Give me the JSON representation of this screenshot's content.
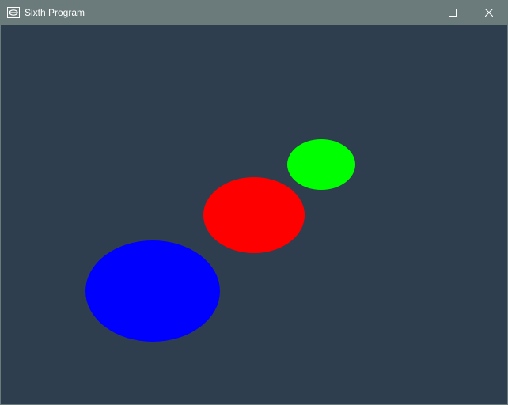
{
  "window": {
    "title": "Sixth Program",
    "controls": {
      "minimize_icon": "minimize-icon",
      "maximize_icon": "maximize-icon",
      "close_icon": "close-icon"
    }
  },
  "canvas": {
    "background": "#2e3e4f",
    "shapes": [
      {
        "name": "green-ellipse",
        "color": "#00ff00"
      },
      {
        "name": "red-ellipse",
        "color": "#ff0000"
      },
      {
        "name": "blue-ellipse",
        "color": "#0000ff"
      }
    ]
  }
}
